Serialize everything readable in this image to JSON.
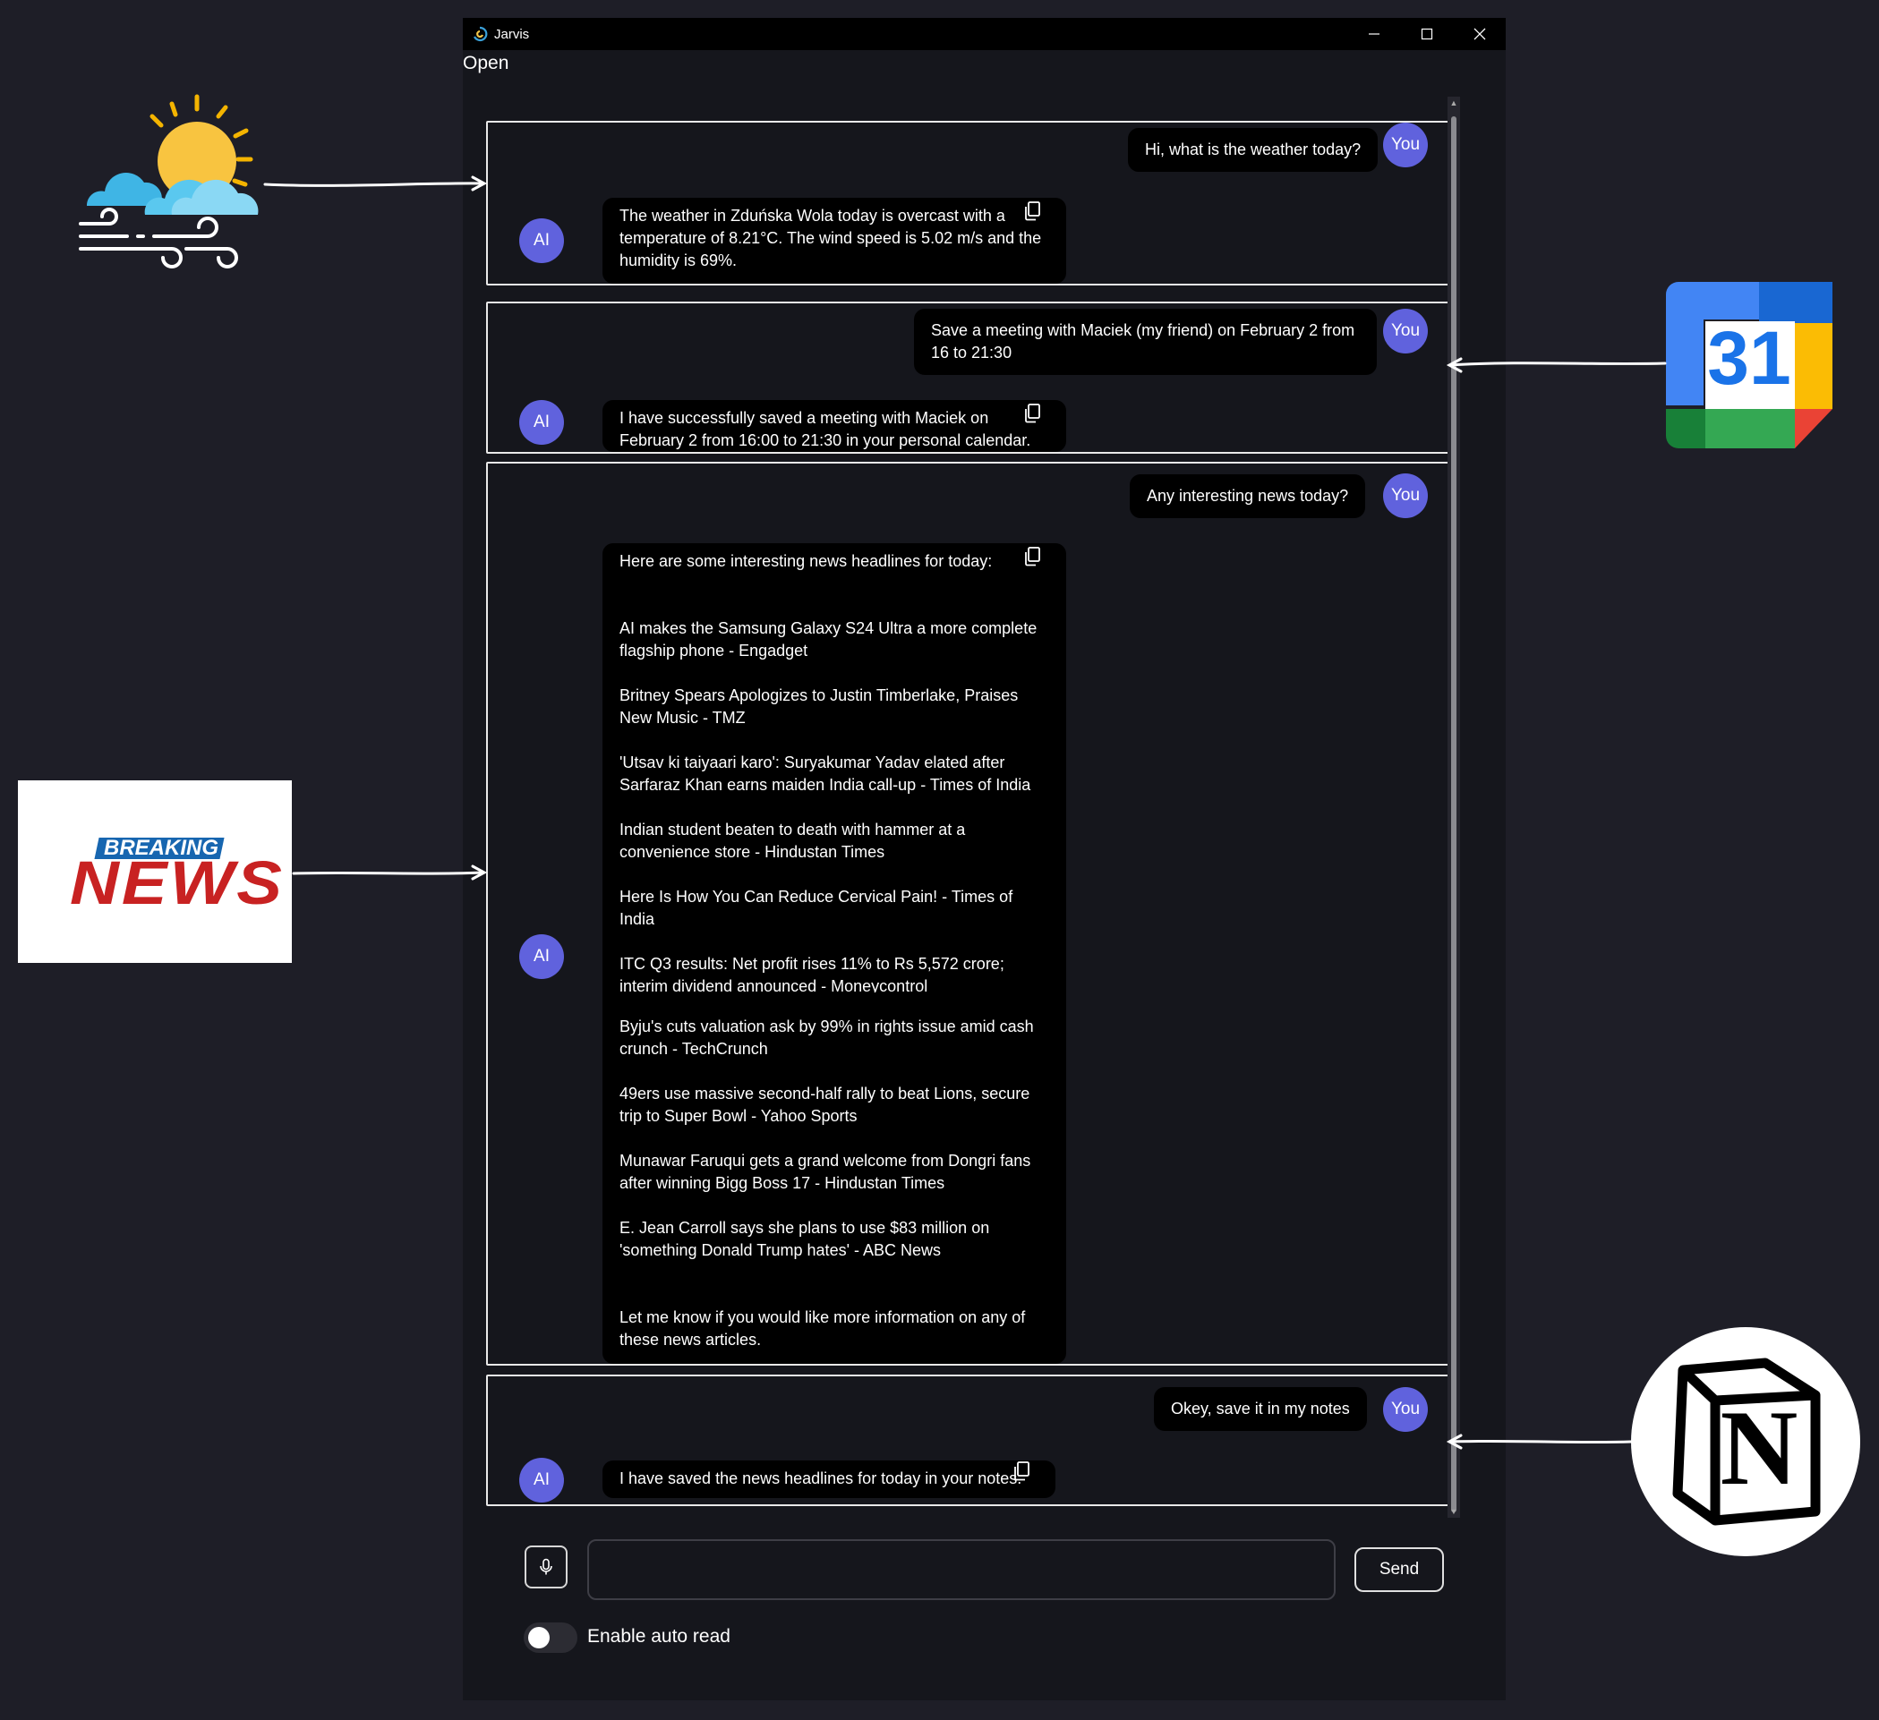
{
  "window": {
    "title": "Jarvis",
    "app_icon": "jarvis-logo-icon"
  },
  "menu": {
    "open_label": "Open"
  },
  "avatars": {
    "user": "You",
    "ai": "AI"
  },
  "conversation": [
    {
      "user": "Hi, what is the weather today?",
      "ai": "The weather in Zduńska Wola today is overcast with a temperature of 8.21°C. The wind speed is 5.02 m/s and the humidity is 69%."
    },
    {
      "user": "Save a meeting with Maciek (my friend) on February 2 from 16 to 21:30",
      "ai": "I have successfully saved a meeting with Maciek on February 2 from 16:00 to 21:30 in your personal calendar."
    },
    {
      "user": "Any interesting news today?",
      "ai_intro": "Here are some interesting news headlines for today:",
      "ai_headlines": [
        "AI makes the Samsung Galaxy S24 Ultra a more complete flagship phone - Engadget",
        "Britney Spears Apologizes to Justin Timberlake, Praises New Music - TMZ",
        "'Utsav ki taiyaari karo': Suryakumar Yadav elated after Sarfaraz Khan earns maiden India call-up - Times of India",
        "Indian student beaten to death with hammer at a convenience store - Hindustan Times",
        "Here Is How You Can Reduce Cervical Pain! - Times of India",
        "ITC Q3 results: Net profit rises 11% to Rs 5,572 crore; interim dividend announced - Moneycontrol",
        "Byju's cuts valuation ask by 99% in rights issue amid cash crunch - TechCrunch",
        "49ers use massive second-half rally to beat Lions, secure trip to Super Bowl - Yahoo Sports",
        "Munawar Faruqui gets a grand welcome from Dongri fans after winning Bigg Boss 17 - Hindustan Times",
        "E. Jean Carroll says she plans to use $83 million on 'something Donald Trump hates' - ABC News"
      ],
      "ai_outro": "Let me know if you would like more information on any of these news articles."
    },
    {
      "user": "Okey, save it in my notes",
      "ai": "I have saved the news headlines for today in your notes."
    }
  ],
  "input": {
    "value": "",
    "placeholder": ""
  },
  "buttons": {
    "send": "Send"
  },
  "toggle": {
    "label": "Enable auto read",
    "enabled": false
  },
  "illustrations": {
    "weather": "weather-sun-cloud-wind-icon",
    "calendar": {
      "icon": "google-calendar-icon",
      "day": "31"
    },
    "news": {
      "icon": "breaking-news-logo",
      "line1": "BREAKING",
      "line2": "NEWS"
    },
    "notes": {
      "icon": "notion-logo-icon",
      "letter": "N"
    }
  },
  "colors": {
    "background": "#1e1e27",
    "window": "#15161c",
    "bubble": "#000000",
    "avatar": "#6062dd",
    "annotation": "#ffffff"
  }
}
